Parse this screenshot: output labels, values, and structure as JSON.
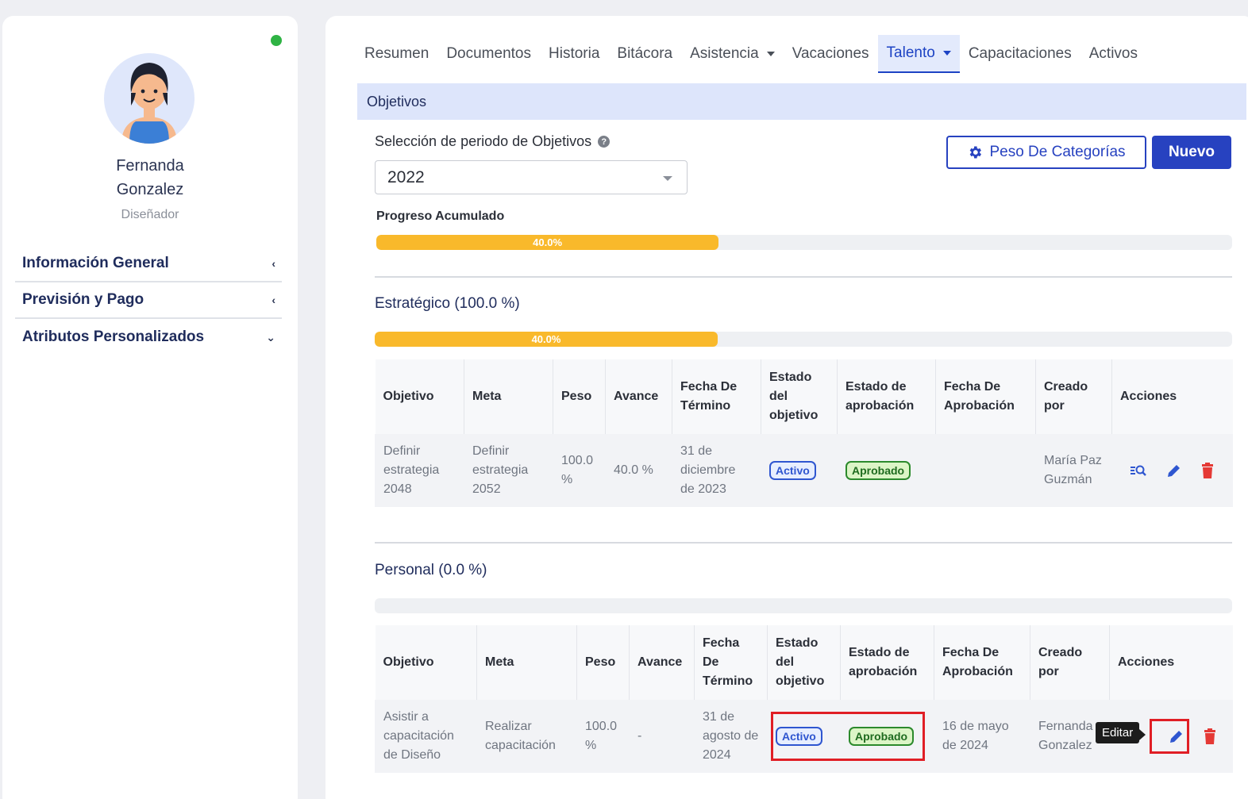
{
  "profile": {
    "first_name": "Fernanda",
    "last_name": "Gonzalez",
    "role": "Diseñador"
  },
  "side_menu": [
    {
      "label": "Información General",
      "chevron": "‹"
    },
    {
      "label": "Previsión y Pago",
      "chevron": "‹"
    },
    {
      "label": "Atributos Personalizados",
      "chevron": "⌄"
    }
  ],
  "tabs": [
    "Resumen",
    "Documentos",
    "Historia",
    "Bitácora",
    "Asistencia",
    "Vacaciones",
    "Talento",
    "Capacitaciones",
    "Activos"
  ],
  "active_tab": "Talento",
  "section": {
    "title": "Objetivos"
  },
  "period": {
    "label": "Selección de periodo de Objetivos",
    "help_icon": "?",
    "selected": "2022"
  },
  "buttons": {
    "peso": "Peso De Categorías",
    "nuevo": "Nuevo"
  },
  "progress": {
    "label": "Progreso Acumulado",
    "value_text": "40.0%",
    "value": 0.4
  },
  "groups": [
    {
      "title": "Estratégico (100.0 %)",
      "progress_text": "40.0%",
      "progress": 0.4,
      "headers": [
        "Objetivo",
        "Meta",
        "Peso",
        "Avance",
        "Fecha De Término",
        "Estado del objetivo",
        "Estado de aprobación",
        "Fecha De Aprobación",
        "Creado por",
        "Acciones"
      ],
      "row": {
        "objetivo": "Definir estrategia 2048",
        "meta": "Definir estrategia 2052",
        "peso": "100.0 %",
        "avance": "40.0 %",
        "fecha_termino": "31 de diciembre de 2023",
        "estado_objetivo": "Activo",
        "estado_aprobacion": "Aprobado",
        "fecha_aprobacion": "",
        "creado_por": "María Paz Guzmán"
      }
    },
    {
      "title": "Personal (0.0 %)",
      "progress_text": "",
      "progress": 0,
      "headers": [
        "Objetivo",
        "Meta",
        "Peso",
        "Avance",
        "Fecha De Término",
        "Estado del objetivo",
        "Estado de aprobación",
        "Fecha De Aprobación",
        "Creado por",
        "Acciones"
      ],
      "row": {
        "objetivo": "Asistir a capacitación de Diseño",
        "meta": "Realizar capacitación",
        "peso": "100.0 %",
        "avance": "-",
        "fecha_termino": "31 de agosto de 2024",
        "estado_objetivo": "Activo",
        "estado_aprobacion": "Aprobado",
        "fecha_aprobacion": "16 de mayo de 2024",
        "creado_por": "Fernanda Gonzalez"
      }
    }
  ],
  "tooltip": "Editar",
  "colors": {
    "accent": "#2742c0",
    "progress": "#f9b92b",
    "online": "#2fb344",
    "delete": "#e53935",
    "highlight": "#e01e25"
  },
  "icons": {
    "view": "search-list-icon",
    "edit": "pencil-icon",
    "delete": "trash-icon",
    "settings": "gear-icon"
  }
}
